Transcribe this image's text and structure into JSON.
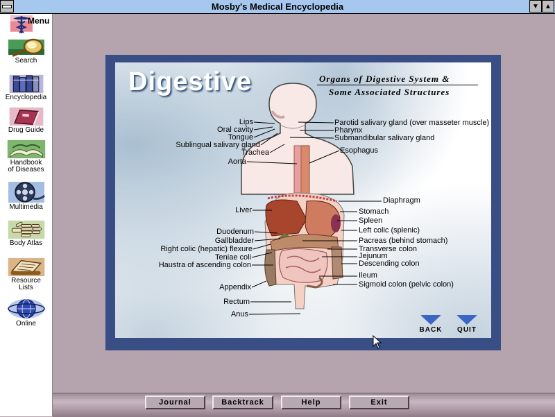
{
  "window": {
    "title": "Mosby's Medical Encyclopedia"
  },
  "sidebar": {
    "items": [
      {
        "label": "Menu",
        "icon": "caduceus-icon"
      },
      {
        "label": "Search",
        "icon": "magnifier-icon"
      },
      {
        "label": "Encyclopedia",
        "icon": "books-icon"
      },
      {
        "label": "Drug Guide",
        "icon": "book-icon"
      },
      {
        "label1": "Handbook",
        "label2": "of Diseases",
        "icon": "open-book-icon"
      },
      {
        "label": "Multimedia",
        "icon": "film-reel-icon"
      },
      {
        "label": "Body Atlas",
        "icon": "skeleton-hand-icon"
      },
      {
        "label1": "Resource",
        "label2": "Lists",
        "icon": "scroll-icon"
      },
      {
        "label": "Online",
        "icon": "globe-icon"
      }
    ]
  },
  "panel": {
    "title": "Digestive",
    "subtitle1": "Organs of Digestive System &",
    "subtitle2": "Some Associated Structures",
    "labels_left": [
      "Lips",
      "Oral cavity",
      "Tongue",
      "Sublingual salivary gland",
      "Trachea",
      "Aorta",
      "Liver",
      "Duodenum",
      "Gallbladder",
      "Right colic (hepatic) flexure",
      "Teniae coli",
      "Haustra of ascending colon",
      "Appendix",
      "Rectum",
      "Anus"
    ],
    "labels_right": [
      "Parotid salivary gland (over masseter muscle)",
      "Pharynx",
      "Submandibular salivary gland",
      "Esophagus",
      "Diaphragm",
      "Stomach",
      "Spleen",
      "Left colic (splenic)",
      "Pacreas (behind stomach)",
      "Transverse colon",
      "Jejunum",
      "Descending colon",
      "Ileum",
      "Sigmoid colon (pelvic colon)"
    ],
    "back_label": "BACK",
    "quit_label": "QUIT"
  },
  "bottom": {
    "journal": "Journal",
    "backtrack": "Backtrack",
    "help": "Help",
    "exit": "Exit"
  },
  "colors": {
    "title_bar": "#a7c8ee",
    "background": "#b5a4ae",
    "frame": "#3a4e86",
    "nav_arrow": "#3a66c4"
  }
}
